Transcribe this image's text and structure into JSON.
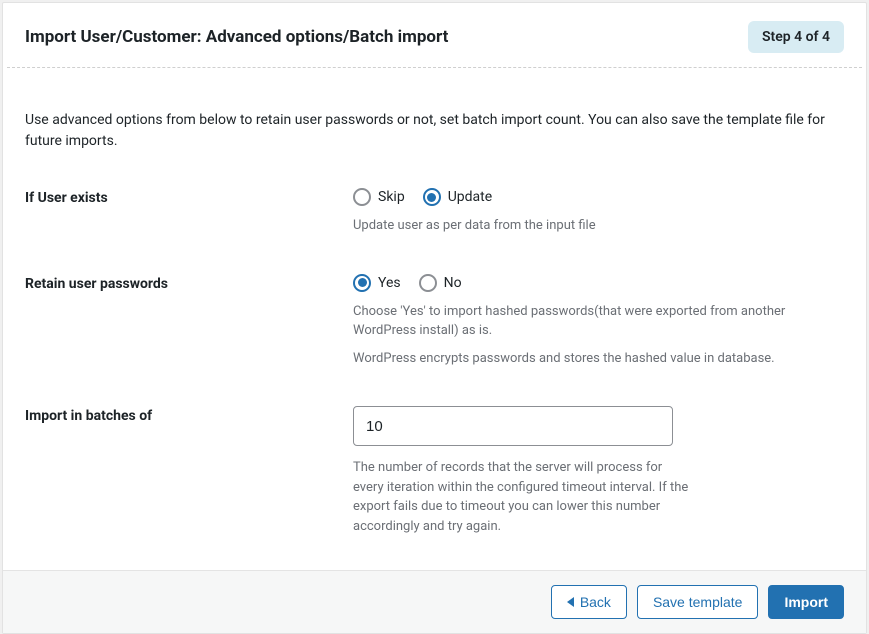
{
  "header": {
    "title": "Import User/Customer: Advanced options/Batch import",
    "step_badge": "Step 4 of 4"
  },
  "intro_text": "Use advanced options from below to retain user passwords or not, set batch import count. You can also save the template file for future imports.",
  "field_user_exists": {
    "label": "If User exists",
    "option_skip": "Skip",
    "option_update": "Update",
    "selected": "update",
    "help": "Update user as per data from the input file"
  },
  "field_retain_passwords": {
    "label": "Retain user passwords",
    "option_yes": "Yes",
    "option_no": "No",
    "selected": "yes",
    "help1": "Choose 'Yes' to import hashed passwords(that were exported from another WordPress install) as is.",
    "help2": "WordPress encrypts passwords and stores the hashed value in database."
  },
  "field_batch": {
    "label": "Import in batches of",
    "value": "10",
    "help": "The number of records that the server will process for every iteration within the configured timeout interval. If the export fails due to timeout you can lower this number accordingly and try again."
  },
  "footer": {
    "back": "Back",
    "save_template": "Save template",
    "import": "Import"
  }
}
